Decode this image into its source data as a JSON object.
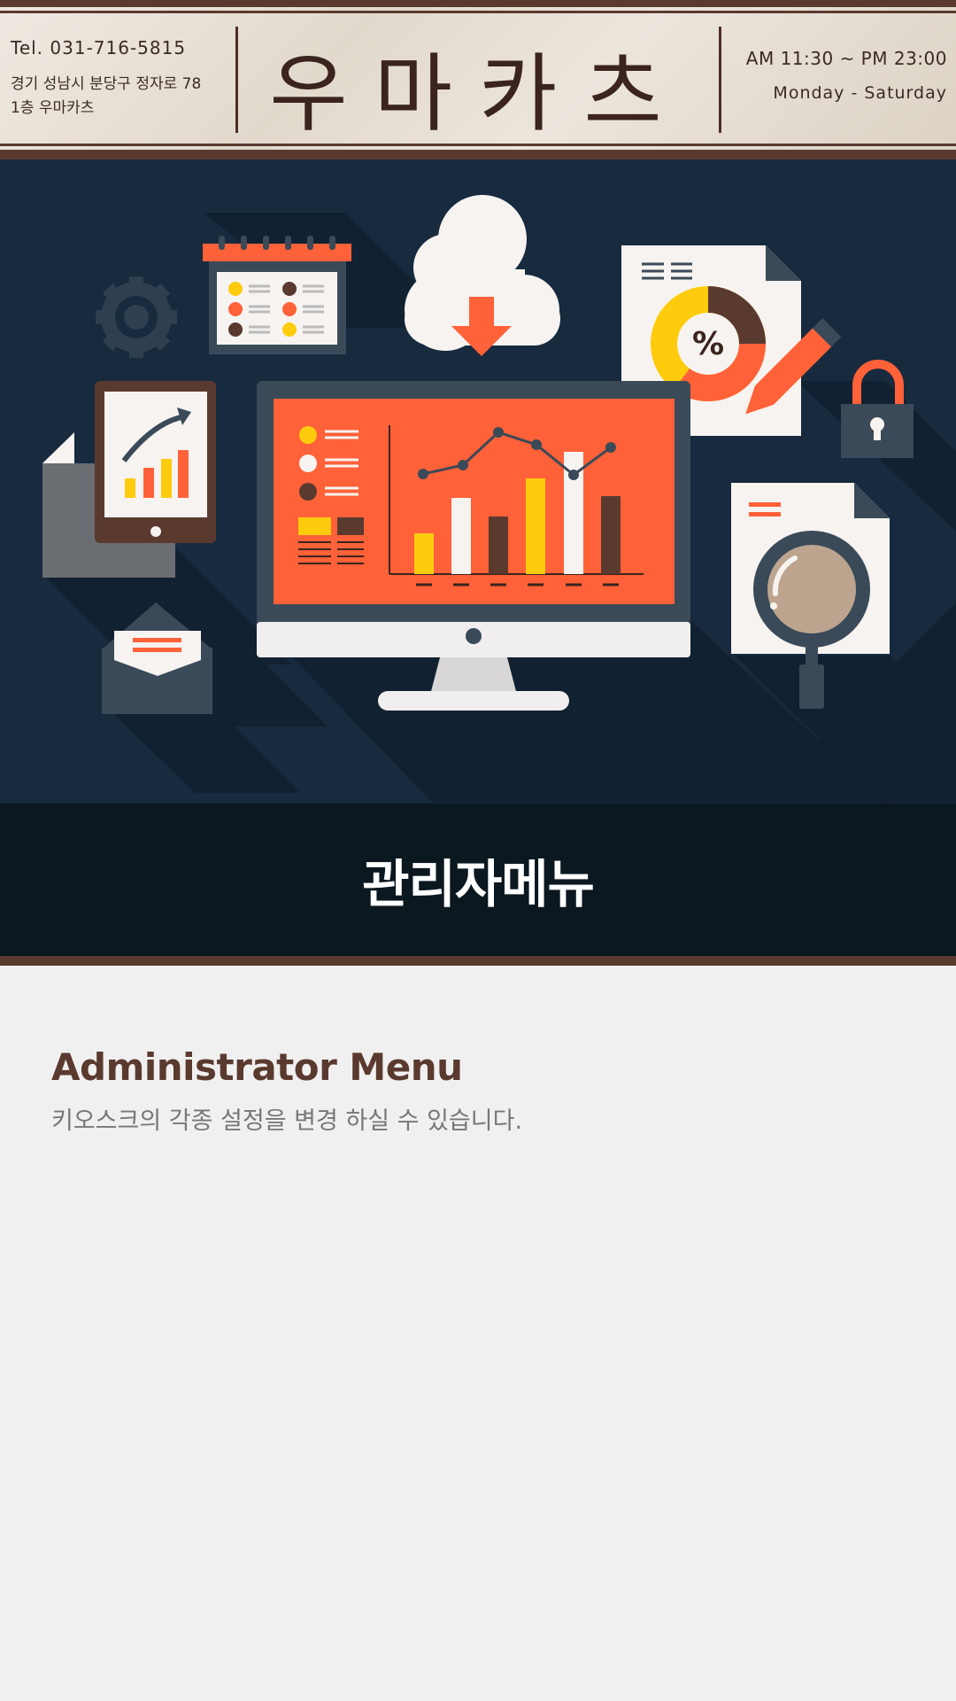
{
  "header": {
    "tel": "Tel. 031-716-5815",
    "address_line1": "경기 성남시 분당구 정자로 78",
    "address_line2": "1층 우마카츠",
    "brand_name": "우마카츠",
    "hours": "AM 11:30 ~ PM 23:00",
    "days": "Monday - Saturday"
  },
  "hero": {
    "illustration": "admin-dashboard-illustration",
    "percent_label": "%"
  },
  "banner": {
    "title": "관리자메뉴"
  },
  "content": {
    "title": "Administrator Menu",
    "description": "키오스크의 각종 설정을 변경 하실 수 있습니다."
  },
  "colors": {
    "brown": "#5a3a2f",
    "navy": "#172a3e",
    "orange": "#ff6138",
    "yellow": "#ffcc0d"
  }
}
